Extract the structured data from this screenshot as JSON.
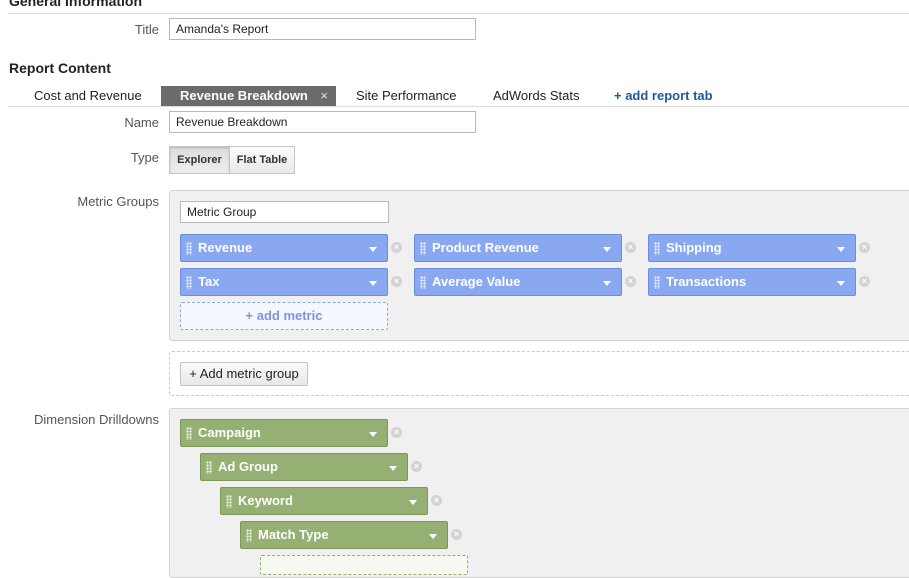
{
  "sections": {
    "general": "General Information",
    "report_content": "Report Content"
  },
  "title_field": {
    "label": "Title",
    "value": "Amanda's Report"
  },
  "tabs": [
    {
      "label": "Cost and Revenue"
    },
    {
      "label": "Revenue Breakdown",
      "close": "×"
    },
    {
      "label": "Site Performance"
    },
    {
      "label": "AdWords Stats"
    },
    {
      "label": "+ add report tab"
    }
  ],
  "name_field": {
    "label": "Name",
    "value": "Revenue Breakdown"
  },
  "type_field": {
    "label": "Type",
    "options": [
      "Explorer",
      "Flat Table"
    ],
    "selected": "Explorer"
  },
  "metric_groups": {
    "label": "Metric Groups",
    "group_name": "Metric Group",
    "metrics": [
      "Revenue",
      "Product Revenue",
      "Shipping",
      "Tax",
      "Average Value",
      "Transactions"
    ],
    "add_metric": "+ add metric",
    "add_group": "+ Add metric group"
  },
  "dimension_drilldowns": {
    "label": "Dimension Drilldowns",
    "dimensions": [
      "Campaign",
      "Ad Group",
      "Keyword",
      "Match Type"
    ]
  },
  "colors": {
    "metric_chip": "#8aa8ef",
    "dimension_chip": "#95b072",
    "active_tab": "#6b6b6b",
    "link": "#1f5a99"
  }
}
